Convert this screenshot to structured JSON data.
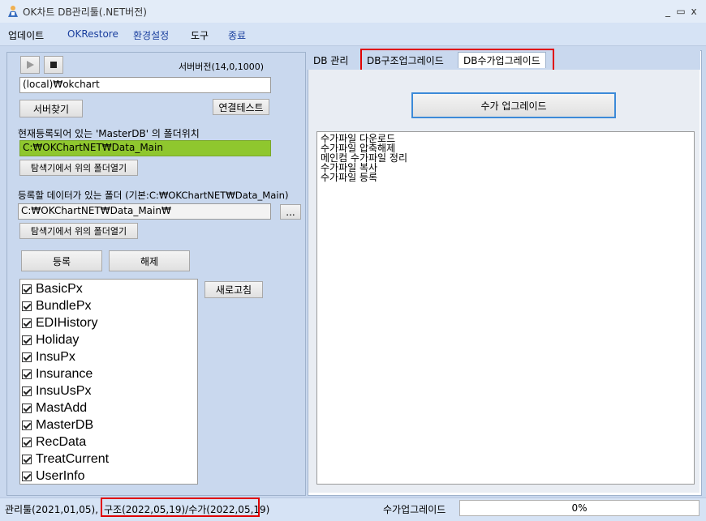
{
  "window": {
    "title": "OK차트 DB관리툴(.NET버전)",
    "minimize": "_",
    "maximize": "▭",
    "close": "x"
  },
  "menu": [
    "업데이트",
    "OKRestore",
    "환경설정",
    "도구",
    "종료"
  ],
  "left": {
    "server_version": "서버버전(14,0,1000)",
    "server_value": "(local)₩okchart",
    "find_server": "서버찾기",
    "test_connection": "연결테스트",
    "master_label": "현재등록되어 있는 'MasterDB' 의 폴더위치",
    "master_path": "C:₩OKChartNET₩Data_Main",
    "open_folder_1": "탐색기에서 위의 폴더열기",
    "data_folder_label": "등록할 데이터가 있는 폴더 (기본:C:₩OKChartNET₩Data_Main)",
    "data_folder_path": "C:₩OKChartNET₩Data_Main₩",
    "browse": "...",
    "open_folder_2": "탐색기에서 위의 폴더열기",
    "register": "등록",
    "unregister": "해제",
    "refresh": "새로고침",
    "databases": [
      "BasicPx",
      "BundlePx",
      "EDIHistory",
      "Holiday",
      "InsuPx",
      "Insurance",
      "InsuUsPx",
      "MastAdd",
      "MasterDB",
      "RecData",
      "TreatCurrent",
      "UserInfo"
    ]
  },
  "tabs": [
    "DB 관리",
    "DB구조업그레이드",
    "DB수가업그레이드"
  ],
  "right": {
    "upgrade_button": "수가 업그레이드",
    "log": [
      "수가파일 다운로드",
      "수가파일 압축해제",
      "메인컴 수가파일 정리",
      "수가파일 복사",
      "수가파일 등록"
    ]
  },
  "status": {
    "tool": "관리툴(2021,01,05),",
    "versions": "구조(2022,05,19)/수가(2022,05,19)",
    "task": "수가업그레이드",
    "progress": "0%",
    "progress_value": 0
  },
  "colors": {
    "accent_highlight": "#e00000",
    "master_path_bg": "#8fc72e",
    "menu_link": "#1a3f9e"
  }
}
